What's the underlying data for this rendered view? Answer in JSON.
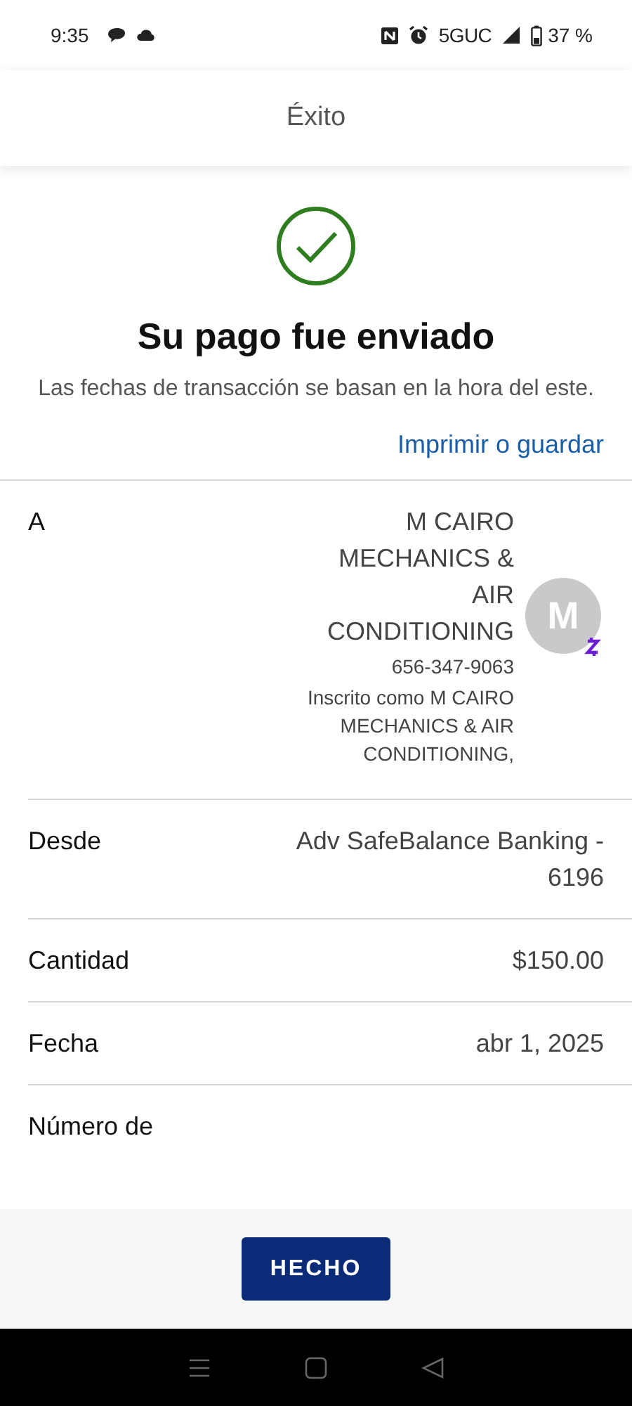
{
  "status_bar": {
    "time": "9:35",
    "network": "5GUC",
    "battery": "37 %"
  },
  "header": {
    "title": "Éxito"
  },
  "confirmation": {
    "title": "Su pago fue enviado",
    "note": "Las fechas de transacción se basan en la hora del este.",
    "print_link": "Imprimir o guardar"
  },
  "recipient": {
    "label": "A",
    "name": "M CAIRO MECHANICS & AIR CONDITIONING",
    "phone": "656-347-9063",
    "registered_as": "Inscrito como M CAIRO MECHANICS & AIR CONDITIONING,",
    "avatar_initial": "M"
  },
  "details": [
    {
      "label": "Desde",
      "value": "Adv SafeBalance Banking - 6196"
    },
    {
      "label": "Cantidad",
      "value": "$150.00"
    },
    {
      "label": "Fecha",
      "value": "abr 1, 2025"
    },
    {
      "label": "Número de"
    }
  ],
  "footer": {
    "button": "HECHO"
  }
}
